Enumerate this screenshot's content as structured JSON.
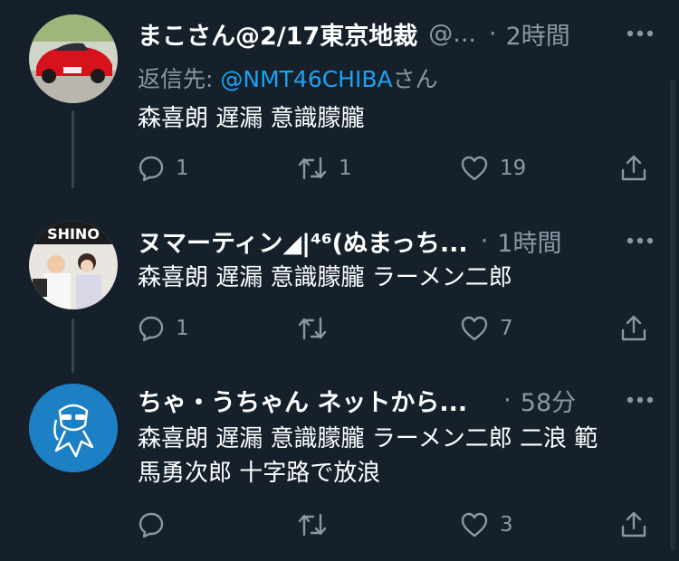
{
  "tweets": [
    {
      "name": "まこさん@2/17東京地裁",
      "handle": "@...",
      "time": "2時間",
      "reply_label": "返信先: ",
      "reply_mention": "@NMT46CHIBA",
      "reply_suffix": "さん",
      "text": "森喜朗 遅漏 意識朦朧",
      "counts": {
        "reply": "1",
        "retweet": "1",
        "like": "19"
      }
    },
    {
      "name": "ヌマーティン◢|⁴⁶(ぬまっち...",
      "time": "1時間",
      "text": "森喜朗 遅漏 意識朦朧 ラーメン二郎",
      "counts": {
        "reply": "1",
        "retweet": "",
        "like": "7"
      }
    },
    {
      "name": "ちゃ・うちゃん ネットから...",
      "time": "58分",
      "text_line1": "森喜朗 遅漏 意識朦朧 ラーメン二郎 二浪 範",
      "text_line2": "馬勇次郎 十字路で放浪",
      "counts": {
        "reply": "",
        "retweet": "",
        "like": "3"
      }
    }
  ],
  "separator": "·",
  "colors": {
    "background": "#15202b",
    "secondary_text": "#8899a6",
    "link": "#1da1f2",
    "thread_line": "#38444d",
    "avatar3_bg": "#1d7fc4"
  },
  "icons": [
    "more-icon",
    "reply-icon",
    "retweet-icon",
    "like-icon",
    "share-icon"
  ]
}
